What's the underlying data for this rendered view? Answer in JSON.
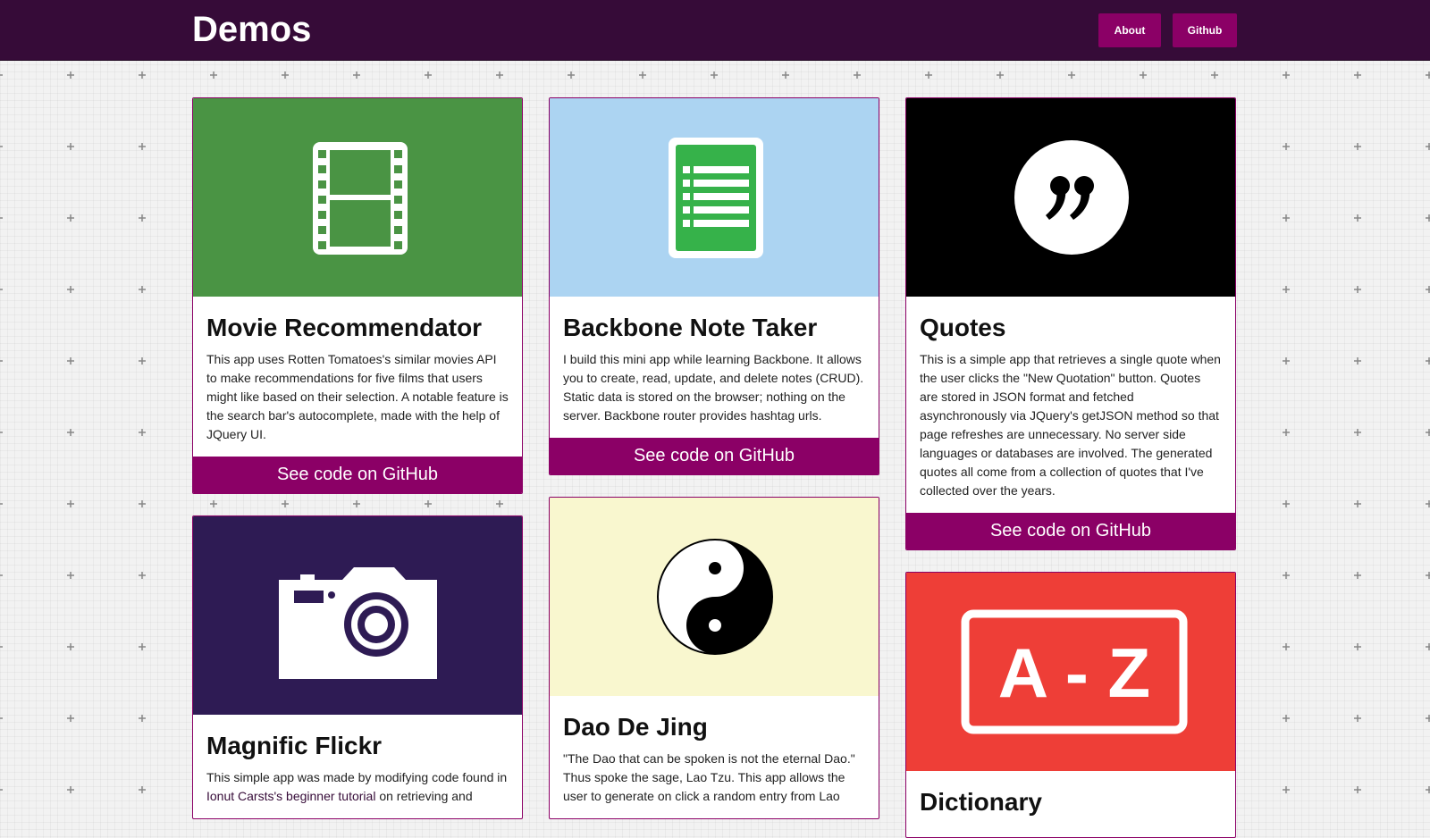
{
  "header": {
    "brand": "Demos",
    "nav": [
      {
        "label": "About"
      },
      {
        "label": "Github"
      }
    ]
  },
  "colors": {
    "topbar": "#360b38",
    "accent": "#8b0066",
    "movie_bg": "#4a9444",
    "backbone_bg": "#acd4f2",
    "quotes_bg": "#000000",
    "flickr_bg": "#2e1b54",
    "dao_bg": "#f9f7cf",
    "dictionary_bg": "#ee3e37"
  },
  "cards": [
    {
      "title": "Movie Recommendator",
      "icon": "film-strip-icon",
      "description": "This app uses Rotten Tomatoes's similar movies API to make recommendations for five films that users might like based on their selection. A notable feature is the search bar's autocomplete, made with the help of JQuery UI.",
      "link": "See code on GitHub"
    },
    {
      "title": "Backbone Note Taker",
      "icon": "notes-document-icon",
      "description": "I build this mini app while learning Backbone. It allows you to create, read, update, and delete notes (CRUD). Static data is stored on the browser; nothing on the server. Backbone router provides hashtag urls.",
      "link": "See code on GitHub"
    },
    {
      "title": "Quotes",
      "icon": "quote-mark-icon",
      "description": "This is a simple app that retrieves a single quote when the user clicks the \"New Quotation\" button. Quotes are stored in JSON format and fetched asynchronously via JQuery's getJSON method so that page refreshes are unnecessary. No server side languages or databases are involved. The generated quotes all come from a collection of quotes that I've collected over the years.",
      "link": "See code on GitHub"
    },
    {
      "title": "Magnific Flickr",
      "icon": "camera-icon",
      "description_pre": "This simple app was made by modifying code found in ",
      "description_link": "Ionut Carsts's beginner tutorial",
      "description_post": " on retrieving and"
    },
    {
      "title": "Dao De Jing",
      "icon": "yin-yang-icon",
      "description": "\"The Dao that can be spoken is not the eternal Dao.\" Thus spoke the sage, Lao Tzu. This app allows the user to generate on click a random entry from Lao"
    },
    {
      "title": "Dictionary",
      "icon": "a-z-dictionary-icon",
      "icon_text": "A - Z"
    }
  ]
}
